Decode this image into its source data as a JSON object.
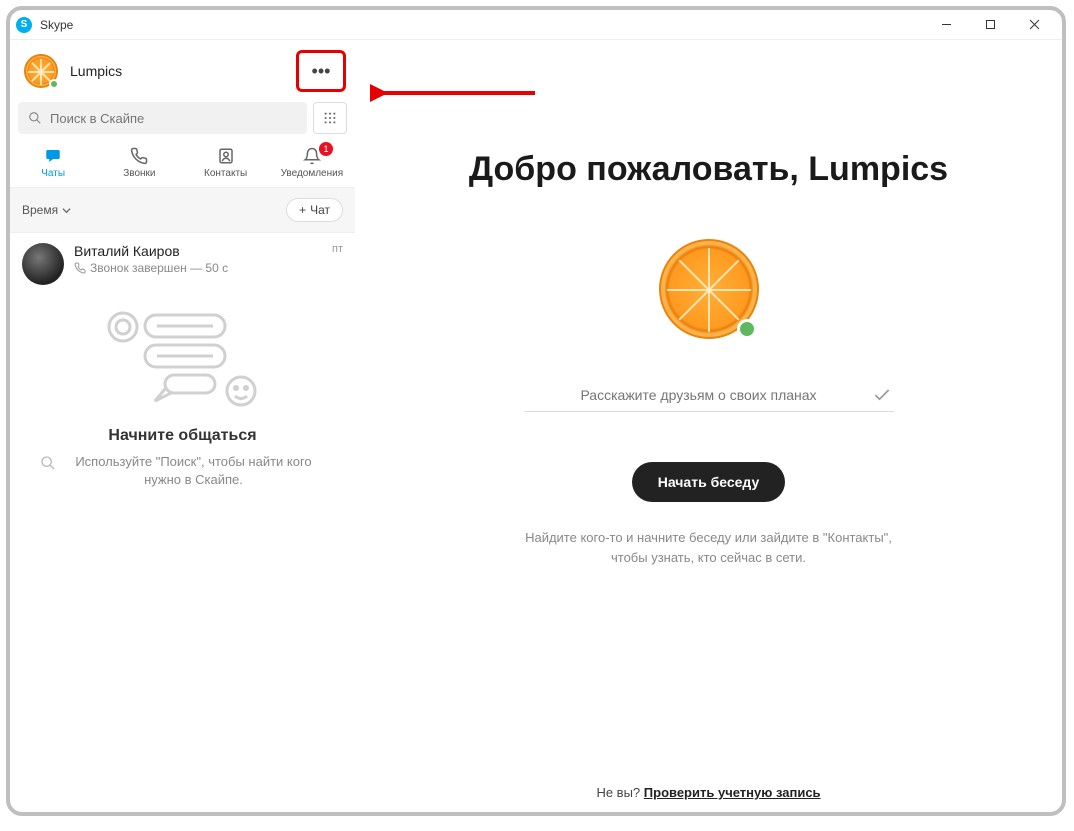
{
  "window": {
    "title": "Skype"
  },
  "profile": {
    "name": "Lumpics",
    "status_color": "#5fb85f"
  },
  "search": {
    "placeholder": "Поиск в Скайпе"
  },
  "tabs": {
    "chats": "Чаты",
    "calls": "Звонки",
    "contacts": "Контакты",
    "notifications": "Уведомления",
    "badge": "1"
  },
  "filter": {
    "label": "Время",
    "new_chat": "Чат"
  },
  "chat_item": {
    "name": "Виталий Каиров",
    "sub": "Звонок завершен — 50 с",
    "time": "пт"
  },
  "empty": {
    "title": "Начните общаться",
    "sub": "Используйте \"Поиск\", чтобы найти кого нужно в Скайпе."
  },
  "main": {
    "welcome": "Добро пожаловать, Lumpics",
    "mood_placeholder": "Расскажите друзьям о своих планах",
    "start_button": "Начать беседу",
    "help": "Найдите кого-то и начните беседу или зайдите в \"Контакты\", чтобы узнать, кто сейчас в сети.",
    "not_you": "Не вы?",
    "verify": "Проверить учетную запись"
  },
  "colors": {
    "accent": "#0099e5",
    "online": "#5fb85f"
  }
}
